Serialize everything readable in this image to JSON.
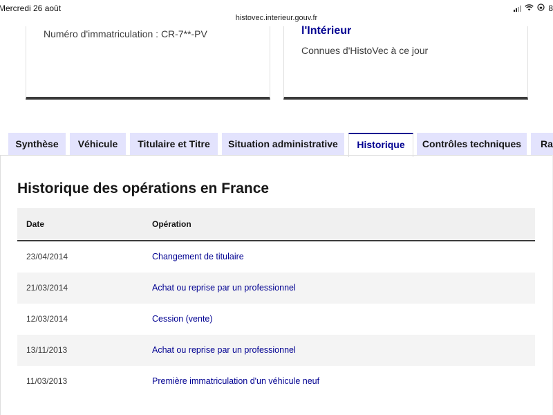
{
  "status_bar": {
    "time": "Mercredi 26 août",
    "battery": "8"
  },
  "browser": {
    "url": "histovec.interieur.gouv.fr"
  },
  "cards": {
    "left_text": "Numéro d'immatriculation : CR-7**-PV",
    "right_title": "l'Intérieur",
    "right_text": "Connues d'HistoVec à ce jour"
  },
  "tabs": [
    {
      "label": "Synthèse",
      "active": false
    },
    {
      "label": "Véhicule",
      "active": false
    },
    {
      "label": "Titulaire et Titre",
      "active": false
    },
    {
      "label": "Situation administrative",
      "active": false
    },
    {
      "label": "Historique",
      "active": true
    },
    {
      "label": "Contrôles techniques",
      "active": false
    },
    {
      "label": "Rap",
      "active": false
    }
  ],
  "section": {
    "title": "Historique des opérations en France"
  },
  "table": {
    "headers": {
      "date": "Date",
      "operation": "Opération"
    },
    "rows": [
      {
        "date": "23/04/2014",
        "operation": "Changement de titulaire"
      },
      {
        "date": "21/03/2014",
        "operation": "Achat ou reprise par un professionnel"
      },
      {
        "date": "12/03/2014",
        "operation": "Cession (vente)"
      },
      {
        "date": "13/11/2013",
        "operation": "Achat ou reprise par un professionnel"
      },
      {
        "date": "11/03/2013",
        "operation": "Première immatriculation d'un véhicule neuf"
      }
    ]
  },
  "colors": {
    "accent": "#000091",
    "tab_bg": "#e3e3fd",
    "card_border": "#3a3a3a"
  }
}
